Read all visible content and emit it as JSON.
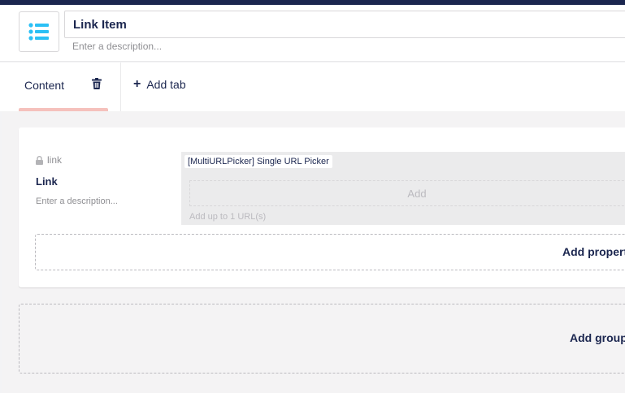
{
  "header": {
    "name_value": "Link Item",
    "description_placeholder": "Enter a description...",
    "icon": "list-icon",
    "accent_color": "#1b264f",
    "icon_color": "#2bc0f5"
  },
  "tabs": {
    "items": [
      {
        "label": "Content",
        "active": true
      }
    ],
    "add_tab_label": "Add tab",
    "active_underline_color": "#f5c1bc"
  },
  "group": {
    "property": {
      "alias": "link",
      "name": "Link",
      "description": "Enter a description...",
      "editor_label": "[MultiURLPicker] Single URL Picker",
      "editor_add_label": "Add",
      "editor_hint": "Add up to 1 URL(s)"
    },
    "add_property_label": "Add property"
  },
  "add_group_label": "Add group"
}
